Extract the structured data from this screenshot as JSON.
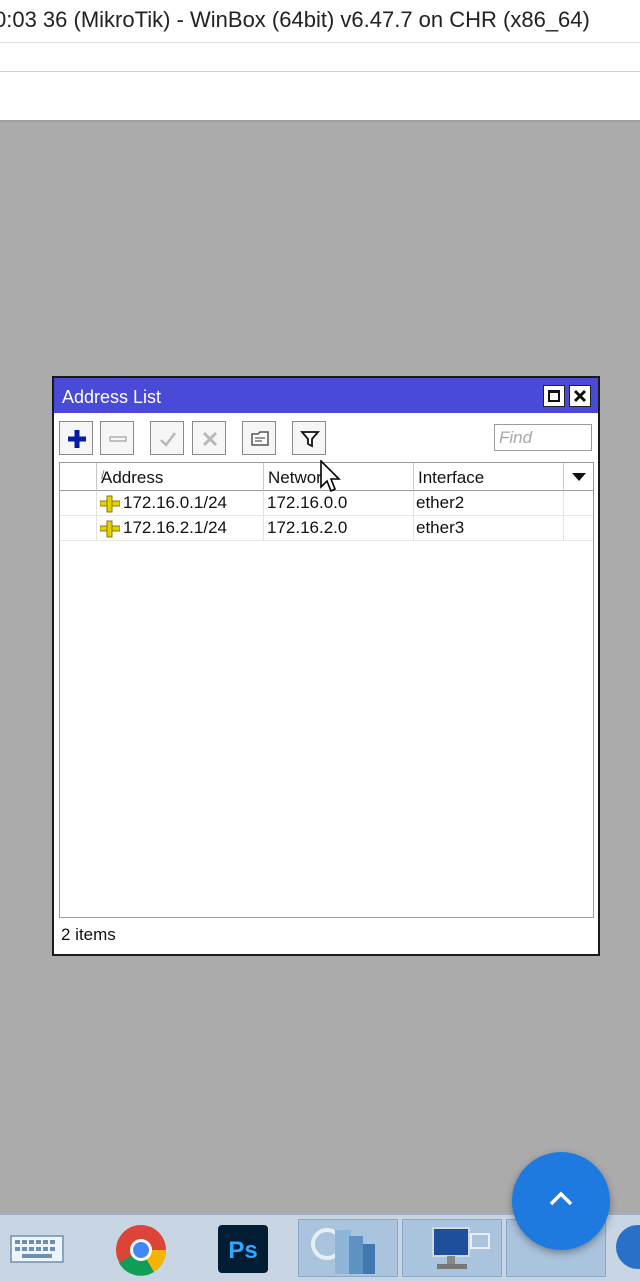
{
  "window": {
    "title": "0:03 36 (MikroTik) - WinBox (64bit) v6.47.7 on CHR (x86_64)"
  },
  "address_list": {
    "title": "Address List",
    "find_placeholder": "Find",
    "columns": [
      "Address",
      "Network",
      "Interface"
    ],
    "rows": [
      {
        "address": "172.16.0.1/24",
        "network": "172.16.0.0",
        "interface": "ether2"
      },
      {
        "address": "172.16.2.1/24",
        "network": "172.16.2.0",
        "interface": "ether3"
      }
    ],
    "status": "2 items"
  },
  "colors": {
    "titlebar_accent": "#4a4ad8",
    "desktop_bg": "#ababab",
    "scroll_button": "#1f7ae0"
  },
  "icons": [
    "add-icon",
    "remove-icon",
    "enable-icon",
    "disable-icon",
    "comment-icon",
    "filter-icon",
    "ip-address-icon",
    "chevron-up-icon"
  ]
}
